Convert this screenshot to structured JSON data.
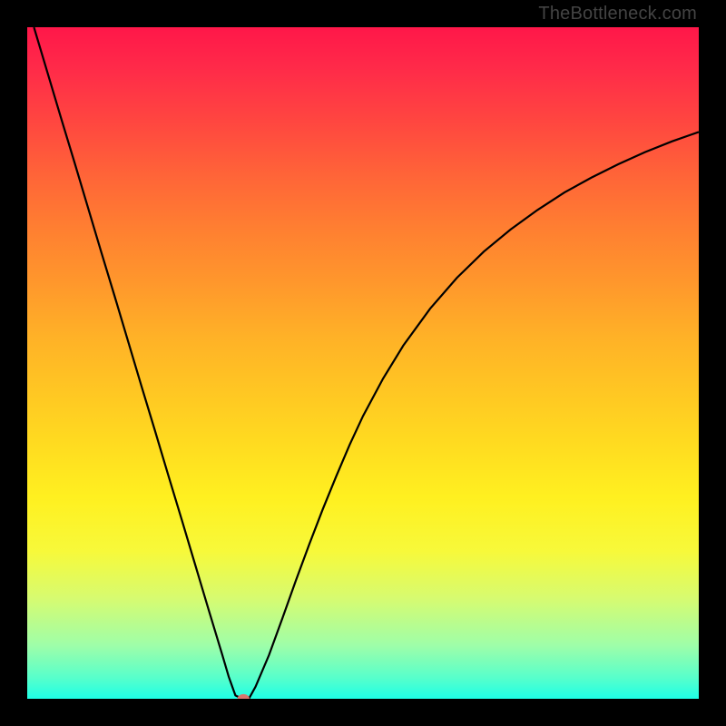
{
  "watermark": "TheBottleneck.com",
  "chart_data": {
    "type": "line",
    "title": "",
    "xlabel": "",
    "ylabel": "",
    "xlim": [
      0,
      100
    ],
    "ylim": [
      0,
      100
    ],
    "grid": false,
    "background_gradient": {
      "stops": [
        {
          "pos": 0.0,
          "color": "#ff1749"
        },
        {
          "pos": 0.14,
          "color": "#ff4640"
        },
        {
          "pos": 0.3,
          "color": "#ff7f31"
        },
        {
          "pos": 0.46,
          "color": "#ffb127"
        },
        {
          "pos": 0.62,
          "color": "#ffdb20"
        },
        {
          "pos": 0.78,
          "color": "#f7f93a"
        },
        {
          "pos": 0.92,
          "color": "#9ffea8"
        },
        {
          "pos": 1.0,
          "color": "#1effe6"
        }
      ]
    },
    "series": [
      {
        "name": "bottleneck-curve",
        "x": [
          1,
          3,
          5,
          7,
          9,
          11,
          13,
          15,
          17,
          19,
          21,
          23,
          25,
          27,
          29,
          30,
          31,
          32,
          33,
          34,
          36,
          38,
          40,
          42,
          44,
          46,
          48,
          50,
          53,
          56,
          60,
          64,
          68,
          72,
          76,
          80,
          84,
          88,
          92,
          96,
          100
        ],
        "y": [
          100,
          93.3,
          86.6,
          80.0,
          73.3,
          66.6,
          60.0,
          53.3,
          46.6,
          40.0,
          33.3,
          26.7,
          20.0,
          13.3,
          6.7,
          3.3,
          0.5,
          0.0,
          0.0,
          1.8,
          6.5,
          12.0,
          17.6,
          23.0,
          28.2,
          33.1,
          37.8,
          42.1,
          47.7,
          52.6,
          58.1,
          62.7,
          66.6,
          69.9,
          72.8,
          75.4,
          77.6,
          79.6,
          81.4,
          83.0,
          84.4
        ]
      }
    ],
    "marker": {
      "x": 32.2,
      "y": 0.0,
      "color": "#d8766e",
      "rx": 0.9,
      "ry": 0.7
    },
    "colors": {
      "curve_stroke": "#000000",
      "frame": "#000000"
    }
  }
}
